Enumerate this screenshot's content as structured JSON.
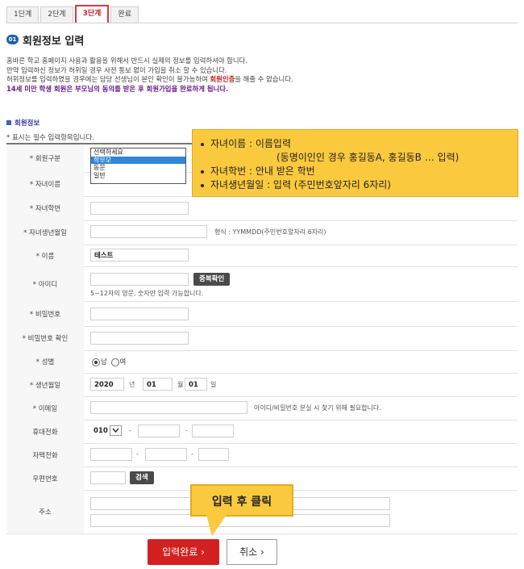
{
  "steps": [
    "1단계",
    "2단계",
    "3단계",
    "완료"
  ],
  "section": {
    "badge": "01",
    "title": "회원정보 입력",
    "intro": [
      "홈바른 학교 홈페이지 사용과 활용을 위해서 반드시 실제의 정보를 입력하셔야 합니다.",
      "만약 입력하신 정보가 허위일 경우 사전 통보 없이 가입을 취소 할 수 있습니다.",
      "허위정보를 입력하였을 경우에는 담당 선생님이 본인 확인이 불가능하여 ",
      "회원인증",
      "을 해줄 수 없습니다.",
      "14세 미만 학생 회원은 부모님의 동의를 받은 후 회원가입을 완료하게 됩니다."
    ]
  },
  "form_section": {
    "title": "회원정보",
    "required_note": "* 표시는 필수 입력항목입니다."
  },
  "labels": {
    "member_type": "* 회원구분",
    "child_name": "* 자녀이름",
    "child_id": "* 자녀학번",
    "child_birth": "* 자녀생년월일",
    "name": "* 이름",
    "user_id": "* 아이디",
    "password": "* 비밀번호",
    "password_confirm": "* 비밀번호 확인",
    "gender": "* 성별",
    "birth": "* 생년월일",
    "email": "* 이메일",
    "mobile": "휴대전화",
    "home_phone": "자택전화",
    "zip": "우편번호",
    "address": "주소"
  },
  "member_type_options": [
    "선택하세요",
    "학부모",
    "동문",
    "일반"
  ],
  "member_type_selected": "학부모",
  "child_birth_hint": "형식 : YYMMDD(주민번호앞자리 6자리)",
  "name_value": "테스트",
  "dup_check_button": "중복확인",
  "user_id_hint": "5~12자의 영문, 숫자만 입력 가능합니다.",
  "gender": {
    "male": "남",
    "female": "여",
    "selected": "남"
  },
  "birth": {
    "year": "2020",
    "year_unit": "년",
    "month": "01",
    "month_unit": "월",
    "day": "01",
    "day_unit": "일"
  },
  "email_hint": "아이디/비밀번호 분실 시 찾기 위해 필요합니다.",
  "mobile_prefix": "010",
  "phone_sep": "-",
  "search_button": "검색",
  "tooltip": {
    "line1": "자녀이름 : 이름입력",
    "line2": "(동명이인인 경우 홍길동A, 홍길동B … 입력)",
    "line3": "자녀학번 : 안내 받은 학번",
    "line4": "자녀생년월일 : 입력 (주민번호앞자리 6자리)"
  },
  "callout": "입력 후 클릭",
  "submit_button": "입력완료 ›",
  "cancel_button": "취소 ›",
  "colors": {
    "accent_red": "#d32020",
    "highlight": "#fbc93d",
    "badge_blue": "#1f5fb3"
  }
}
